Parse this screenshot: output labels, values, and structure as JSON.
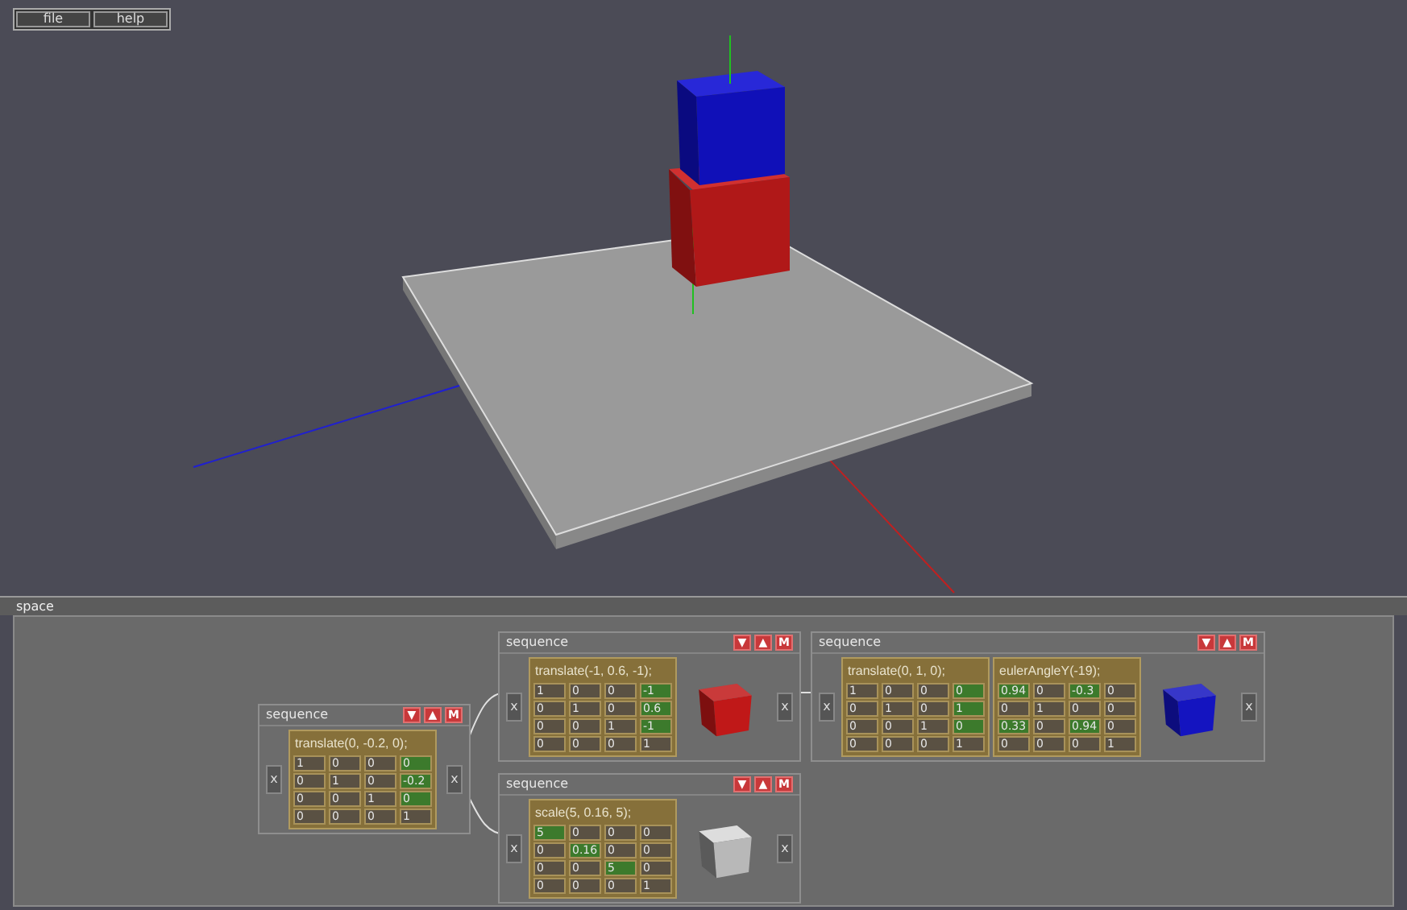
{
  "menu": [
    {
      "label": "file"
    },
    {
      "label": "help"
    }
  ],
  "panel": {
    "title": "space"
  },
  "nodes": [
    {
      "title": "sequence",
      "buttons": [
        "▼",
        "▲",
        "M"
      ],
      "input": "x",
      "output": "x",
      "kind": "plain",
      "matrices": [
        {
          "label": "translate(0, -0.2, 0);",
          "cells": [
            [
              "1",
              "0",
              "0",
              "0"
            ],
            [
              "0",
              "1",
              "0",
              "-0.2"
            ],
            [
              "0",
              "0",
              "1",
              "0"
            ],
            [
              "0",
              "0",
              "0",
              "1"
            ]
          ],
          "highlighted": [
            [
              false,
              false,
              false,
              true
            ],
            [
              false,
              false,
              false,
              true
            ],
            [
              false,
              false,
              false,
              true
            ],
            [
              false,
              false,
              false,
              false
            ]
          ]
        }
      ]
    },
    {
      "title": "sequence",
      "buttons": [
        "▼",
        "▲",
        "M"
      ],
      "input": "x",
      "output": "x",
      "kind": "cube",
      "color": "#c01818",
      "matrices": [
        {
          "label": "translate(-1, 0.6, -1);",
          "cells": [
            [
              "1",
              "0",
              "0",
              "-1"
            ],
            [
              "0",
              "1",
              "0",
              "0.6"
            ],
            [
              "0",
              "0",
              "1",
              "-1"
            ],
            [
              "0",
              "0",
              "0",
              "1"
            ]
          ],
          "highlighted": [
            [
              false,
              false,
              false,
              true
            ],
            [
              false,
              false,
              false,
              true
            ],
            [
              false,
              false,
              false,
              true
            ],
            [
              false,
              false,
              false,
              false
            ]
          ]
        }
      ]
    },
    {
      "title": "sequence",
      "buttons": [
        "▼",
        "▲",
        "M"
      ],
      "input": "x",
      "output": "x",
      "kind": "wireframe",
      "matrices": [
        {
          "label": "scale(5, 0.16, 5);",
          "cells": [
            [
              "5",
              "0",
              "0",
              "0"
            ],
            [
              "0",
              "0.16",
              "0",
              "0"
            ],
            [
              "0",
              "0",
              "5",
              "0"
            ],
            [
              "0",
              "0",
              "0",
              "1"
            ]
          ],
          "highlighted": [
            [
              true,
              false,
              false,
              false
            ],
            [
              false,
              true,
              false,
              false
            ],
            [
              false,
              false,
              true,
              false
            ],
            [
              false,
              false,
              false,
              false
            ]
          ]
        }
      ]
    },
    {
      "title": "sequence",
      "buttons": [
        "▼",
        "▲",
        "M"
      ],
      "input": "x",
      "output": "x",
      "kind": "cube",
      "color": "#1414c0",
      "matrices": [
        {
          "label": "translate(0, 1, 0);",
          "cells": [
            [
              "1",
              "0",
              "0",
              "0"
            ],
            [
              "0",
              "1",
              "0",
              "1"
            ],
            [
              "0",
              "0",
              "1",
              "0"
            ],
            [
              "0",
              "0",
              "0",
              "1"
            ]
          ],
          "highlighted": [
            [
              false,
              false,
              false,
              true
            ],
            [
              false,
              false,
              false,
              true
            ],
            [
              false,
              false,
              false,
              true
            ],
            [
              false,
              false,
              false,
              false
            ]
          ]
        },
        {
          "label": "eulerAngleY(-19);",
          "cells": [
            [
              "0.94",
              "0",
              "-0.3",
              "0"
            ],
            [
              "0",
              "1",
              "0",
              "0"
            ],
            [
              "0.33",
              "0",
              "0.94",
              "0"
            ],
            [
              "0",
              "0",
              "0",
              "1"
            ]
          ],
          "highlighted": [
            [
              true,
              false,
              true,
              false
            ],
            [
              false,
              false,
              false,
              false
            ],
            [
              true,
              false,
              true,
              false
            ],
            [
              false,
              false,
              false,
              false
            ]
          ]
        }
      ]
    }
  ]
}
